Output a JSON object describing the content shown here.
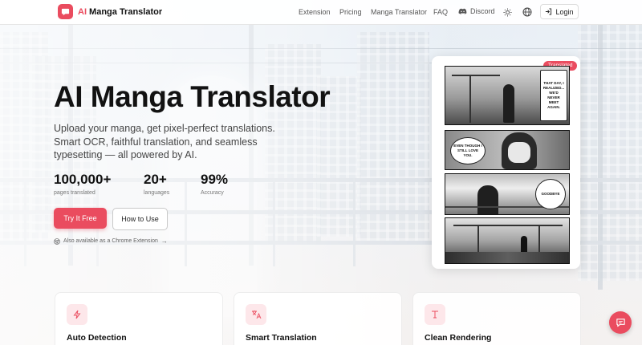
{
  "nav": {
    "brand_ai": "AI",
    "brand_rest": " Manga Translator",
    "links": [
      "Extension",
      "Pricing",
      "Manga Translator",
      "FAQ",
      "Discord"
    ],
    "login": "Login"
  },
  "hero": {
    "title": "AI Manga Translator",
    "subtitle": "Upload your manga, get pixel-perfect translations. Smart OCR, faithful translation, and seamless typesetting — all powered by AI.",
    "stats": [
      {
        "value": "100,000+",
        "label": "pages translated"
      },
      {
        "value": "20+",
        "label": "languages"
      },
      {
        "value": "99%",
        "label": "Accuracy"
      }
    ],
    "primary_button": "Try It Free",
    "secondary_button": "How to Use",
    "extension_note": "Also available as a Chrome Extension"
  },
  "preview": {
    "badge": "Translated",
    "bubbles": [
      "THAT DAY, I REALIZED... WE'D NEVER MEET AGAIN.",
      "EVEN THOUGH I STILL LOVE YOU.",
      "GOODBYE"
    ]
  },
  "features": [
    {
      "title": "Auto Detection",
      "icon": "bolt-icon"
    },
    {
      "title": "Smart Translation",
      "icon": "translate-icon"
    },
    {
      "title": "Clean Rendering",
      "icon": "text-icon"
    }
  ],
  "colors": {
    "accent": "#ea4c5f",
    "accent_soft": "#fde7ea",
    "text_dark": "#121212"
  }
}
